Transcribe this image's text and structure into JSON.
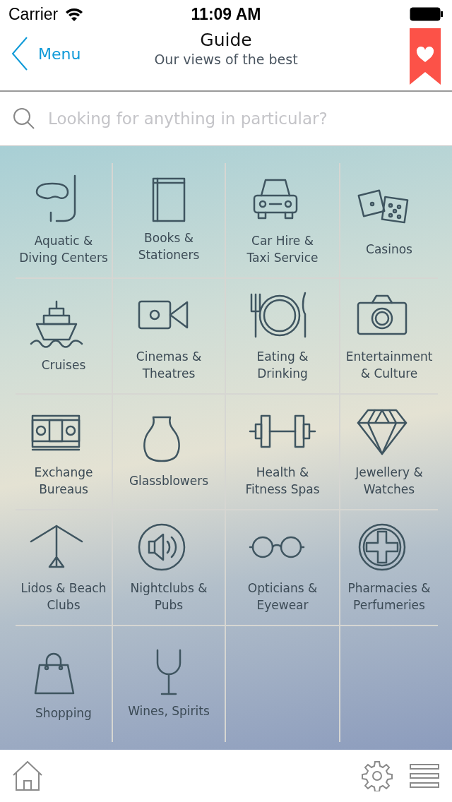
{
  "status_bar": {
    "carrier": "Carrier",
    "time": "11:09 AM"
  },
  "nav": {
    "back": "Menu",
    "title": "Guide",
    "subtitle": "Our views of the best"
  },
  "search": {
    "placeholder": "Looking for anything in particular?"
  },
  "categories": [
    {
      "label": "Aquatic &\nDiving Centers"
    },
    {
      "label": "Books &\nStationers"
    },
    {
      "label": "Car Hire &\nTaxi Service"
    },
    {
      "label": "Casinos"
    },
    {
      "label": "Cruises"
    },
    {
      "label": "Cinemas &\nTheatres"
    },
    {
      "label": "Eating &\nDrinking"
    },
    {
      "label": "Entertainment\n& Culture"
    },
    {
      "label": "Exchange\nBureaus"
    },
    {
      "label": "Glassblowers"
    },
    {
      "label": "Health &\nFitness Spas"
    },
    {
      "label": "Jewellery &\nWatches"
    },
    {
      "label": "Lidos & Beach\nClubs"
    },
    {
      "label": "Nightclubs &\nPubs"
    },
    {
      "label": "Opticians &\nEyewear"
    },
    {
      "label": "Pharmacies &\nPerfumeries"
    },
    {
      "label": "Shopping"
    },
    {
      "label": "Wines, Spirits"
    }
  ]
}
